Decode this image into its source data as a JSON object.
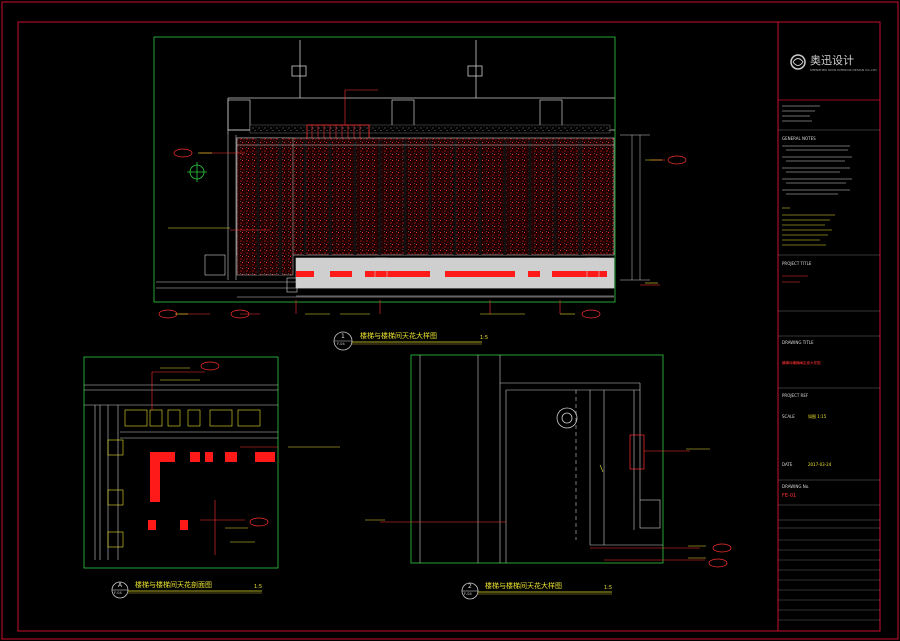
{
  "colors": {
    "background": "#000000",
    "frame_red": "#c8102e",
    "viewport_green": "#2ecc40",
    "line_white": "#e6e6e6",
    "hatch_red": "#d01010",
    "text_yellow": "#e8e030",
    "fill_red": "#ff1a1a"
  },
  "logo": {
    "name": "奥迅设计",
    "tagline": "SHENZHEN OXUN INTERIOR DESIGN CO.,LTD"
  },
  "title_block": {
    "general_notes_label": "GENERAL NOTES",
    "project_title_label": "PROJECT TITLE",
    "drawing_title_label": "DRAWING TITLE",
    "drawing_title_value": "楼梯与楼梯间立面大样图",
    "project_ref_label": "PROJECT REF",
    "scale_label": "SCALE",
    "scale_value": "如图 1:15",
    "date_label": "DATE",
    "date_value": "2017-03-24",
    "drawing_no_label": "DRAWING No.",
    "drawing_no_value": "FE-01"
  },
  "views": [
    {
      "num": "1",
      "ref": "F-04",
      "title": "楼梯与楼梯间天花大样图",
      "scale": "1:5"
    },
    {
      "num": "A",
      "ref": "F-04",
      "title": "楼梯与楼梯间天花剖面图",
      "scale": "1:5"
    },
    {
      "num": "2",
      "ref": "F-04",
      "title": "楼梯与楼梯间天花大样图",
      "scale": "1:5"
    }
  ]
}
